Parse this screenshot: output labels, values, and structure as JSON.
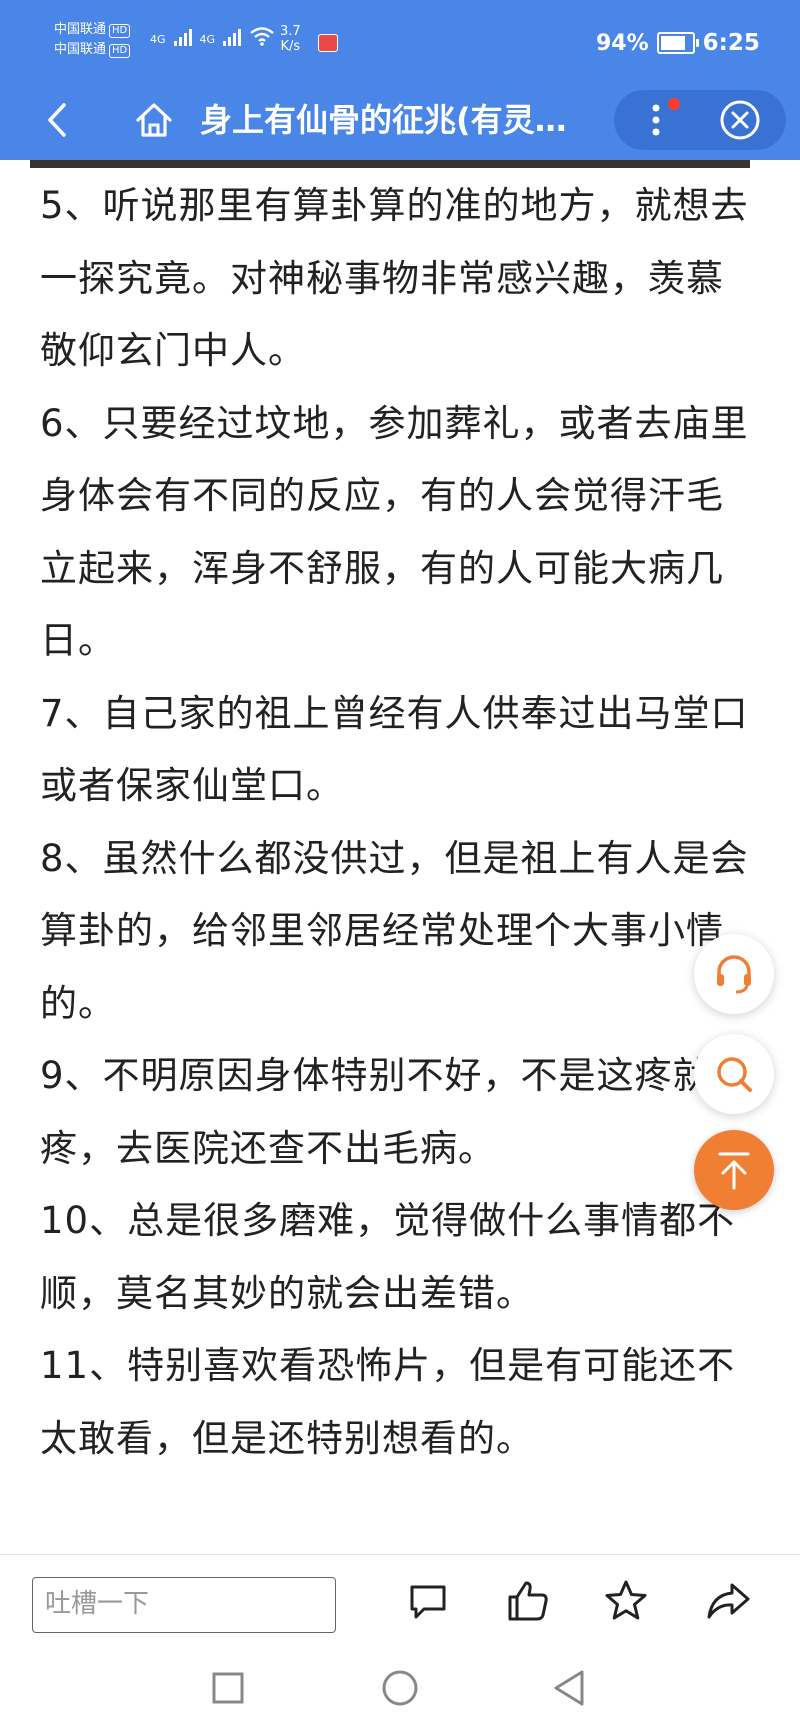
{
  "status_bar": {
    "carrier_1": "中国联通",
    "carrier_2": "中国联通",
    "hd_label": "HD",
    "net_1": "4G",
    "net_2": "4G",
    "speed_value": "3.7",
    "speed_unit": "K/s",
    "battery_percent": "94%",
    "battery_level": 0.94,
    "time": "6:25"
  },
  "nav": {
    "title": "身上有仙骨的征兆(有灵…"
  },
  "article": {
    "paragraphs": [
      "5、听说那里有算卦算的准的地方，就想去一探究竟。对神秘事物非常感兴趣，羡慕敬仰玄门中人。",
      "6、只要经过坟地，参加葬礼，或者去庙里身体会有不同的反应，有的人会觉得汗毛立起来，浑身不舒服，有的人可能大病几日。",
      "7、自己家的祖上曾经有人供奉过出马堂口或者保家仙堂口。",
      "8、虽然什么都没供过，但是祖上有人是会算卦的，给邻里邻居经常处理个大事小情的。",
      "9、不明原因身体特别不好，不是这疼就那疼，去医院还查不出毛病。",
      "10、总是很多磨难，觉得做什么事情都不顺，莫名其妙的就会出差错。",
      "11、特别喜欢看恐怖片，但是有可能还不太敢看，但是还特别想看的。"
    ]
  },
  "bottom_bar": {
    "comment_placeholder": "吐槽一下"
  },
  "icons": {
    "back": "back-arrow-icon",
    "home": "home-icon",
    "menu": "more-vertical-icon",
    "close": "close-circle-icon",
    "support": "headset-icon",
    "search": "search-icon",
    "top": "arrow-up-icon",
    "comment": "comment-icon",
    "like": "thumbs-up-icon",
    "favorite": "star-icon",
    "share": "share-icon"
  },
  "colors": {
    "header": "#4a86e8",
    "accent": "#f07e33",
    "badge": "#ff3b30"
  }
}
